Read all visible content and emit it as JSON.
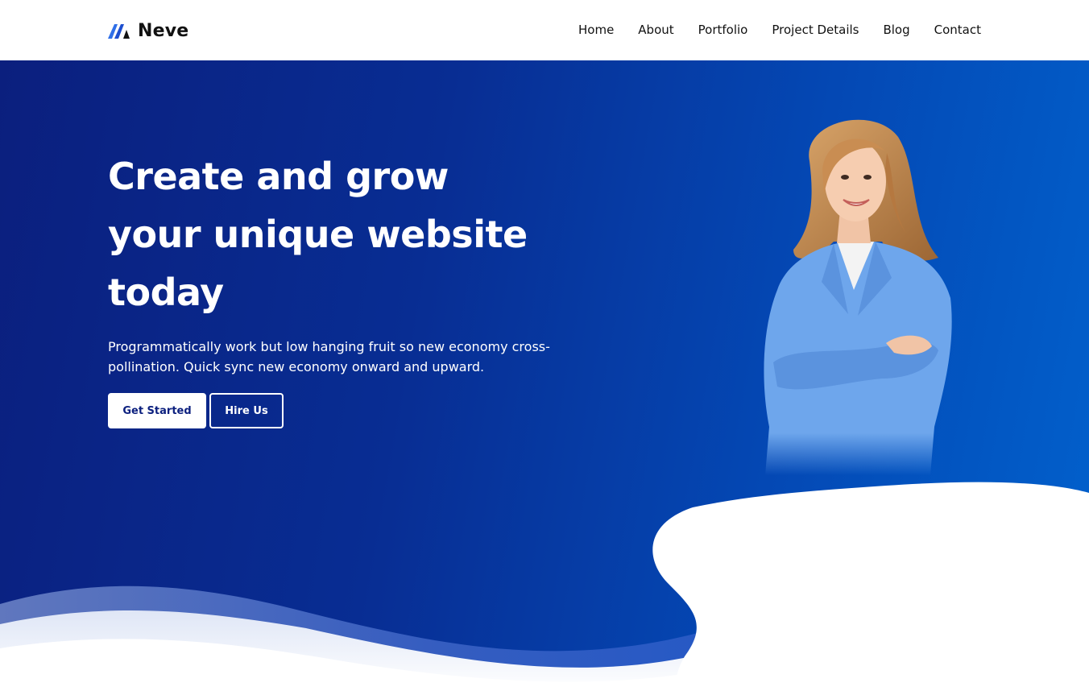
{
  "header": {
    "brand": "Neve",
    "nav": [
      "Home",
      "About",
      "Portfolio",
      "Project Details",
      "Blog",
      "Contact"
    ]
  },
  "hero": {
    "title_lines": [
      "Create and grow",
      "your unique website",
      "today"
    ],
    "description": "Programmatically work but low hanging fruit so new economy cross-pollination. Quick sync new economy onward and upward.",
    "primary_button": "Get Started",
    "secondary_button": "Hire Us"
  },
  "colors": {
    "gradient_start": "#0b1f7e",
    "gradient_end": "#0161cd",
    "brand_blue": "#1a5bd8",
    "text_dark": "#111111",
    "blazer": "#6ea6ec"
  },
  "icons": {
    "logo": "neve-logo-icon"
  }
}
